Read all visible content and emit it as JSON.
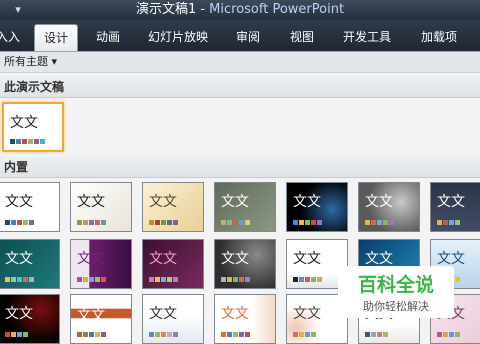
{
  "window": {
    "quick_access": "▾",
    "doc_title": "演示文稿1 - ",
    "app_name": "Microsoft PowerPoint"
  },
  "tabs": [
    "入入",
    "设计",
    "动画",
    "幻灯片放映",
    "审阅",
    "视图",
    "开发工具",
    "加载项"
  ],
  "filter": {
    "label": "所有主题",
    "arrow": "▾"
  },
  "sections": {
    "this_presentation": "此演示文稿",
    "builtin": "内置"
  },
  "theme_title_text": "文文",
  "watermark": {
    "title": "百科全说",
    "subtitle": "助你轻松解决"
  },
  "colors": {
    "selection": "#f3a72f",
    "ribbon_dark": "#26303d",
    "watermark_green": "#3bb54a"
  }
}
